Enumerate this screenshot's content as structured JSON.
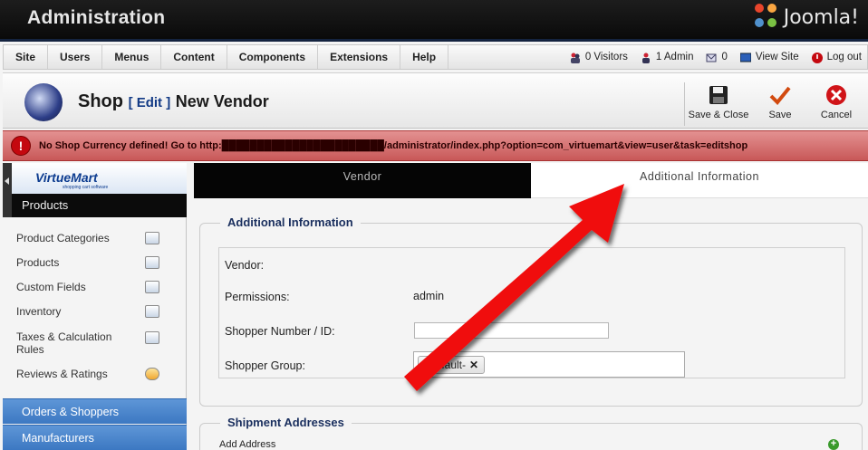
{
  "header": {
    "title": "Administration",
    "brand": "Joomla!"
  },
  "menu": [
    "Site",
    "Users",
    "Menus",
    "Content",
    "Components",
    "Extensions",
    "Help"
  ],
  "status": {
    "visitors": "0 Visitors",
    "admins": "1 Admin",
    "messages": "0",
    "view_site": "View Site",
    "logout": "Log out"
  },
  "toolbar": {
    "title": "Shop",
    "edit": "[ Edit ]",
    "subtitle": "New Vendor",
    "save_close": "Save & Close",
    "save": "Save",
    "cancel": "Cancel"
  },
  "error": {
    "message": "No Shop Currency defined! Go to http:███████████████████████/administrator/index.php?option=com_virtuemart&view=user&task=editshop"
  },
  "sidebar": {
    "logo": "VirtueMart",
    "logo_tag": "shopping cart software",
    "active_section": "Products",
    "items": [
      {
        "label": "Product Categories"
      },
      {
        "label": "Products"
      },
      {
        "label": "Custom Fields"
      },
      {
        "label": "Inventory"
      },
      {
        "label": "Taxes & Calculation Rules"
      },
      {
        "label": "Reviews & Ratings"
      }
    ],
    "sections": [
      "Orders & Shoppers",
      "Manufacturers"
    ]
  },
  "tabs": {
    "vendor": "Vendor",
    "additional": "Additional Information"
  },
  "form": {
    "legend": "Additional Information",
    "vendor_label": "Vendor:",
    "permissions_label": "Permissions:",
    "permissions_value": "admin",
    "shopper_number_label": "Shopper Number / ID:",
    "shopper_number_value": "",
    "shopper_group_label": "Shopper Group:",
    "shopper_group_value": "-Default-"
  },
  "shipment": {
    "legend": "Shipment Addresses",
    "add": "Add Address"
  },
  "colors": {
    "error": "#c85858",
    "section": "#3c78c2",
    "annotation": "#f01010"
  }
}
